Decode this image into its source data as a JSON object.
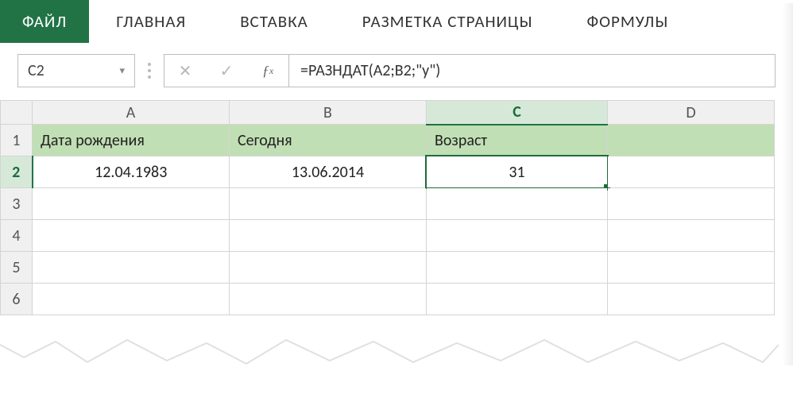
{
  "ribbon": {
    "tabs": [
      "ФАЙЛ",
      "ГЛАВНАЯ",
      "ВСТАВКА",
      "РАЗМЕТКА СТРАНИЦЫ",
      "ФОРМУЛЫ"
    ],
    "active": "ФАЙЛ"
  },
  "name_box": "C2",
  "formula_bar": "=РАЗНДАТ(A2;B2;\"y\")",
  "columns": [
    "A",
    "B",
    "C",
    "D"
  ],
  "rows": [
    "1",
    "2",
    "3",
    "4",
    "5",
    "6"
  ],
  "active_col": "C",
  "active_row": "2",
  "data": {
    "r1": {
      "A": "Дата рождения",
      "B": "Сегодня",
      "C": "Возраст",
      "D": ""
    },
    "r2": {
      "A": "12.04.1983",
      "B": "13.06.2014",
      "C": "31",
      "D": ""
    },
    "r3": {
      "A": "",
      "B": "",
      "C": "",
      "D": ""
    },
    "r4": {
      "A": "",
      "B": "",
      "C": "",
      "D": ""
    },
    "r5": {
      "A": "",
      "B": "",
      "C": "",
      "D": ""
    },
    "r6": {
      "A": "",
      "B": "",
      "C": "",
      "D": ""
    }
  },
  "icons": {
    "dropdown": "▾",
    "cancel": "✕",
    "enter": "✓",
    "fx": "ƒx"
  }
}
